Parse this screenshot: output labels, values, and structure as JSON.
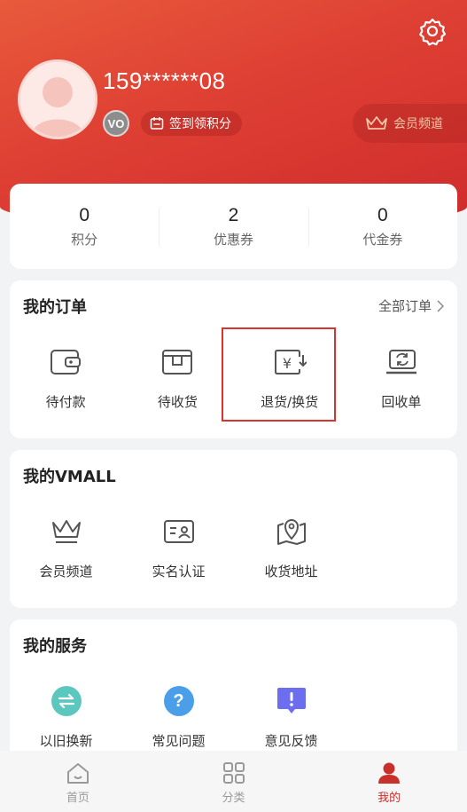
{
  "profile": {
    "phone": "159******08",
    "level_badge": "VO",
    "signin_label": "签到领积分",
    "member_channel_label": "会员频道"
  },
  "stats": [
    {
      "value": "0",
      "label": "积分"
    },
    {
      "value": "2",
      "label": "优惠券"
    },
    {
      "value": "0",
      "label": "代金券"
    }
  ],
  "orders": {
    "title": "我的订单",
    "all_link": "全部订单",
    "items": [
      {
        "label": "待付款",
        "icon": "wallet-icon"
      },
      {
        "label": "待收货",
        "icon": "package-icon"
      },
      {
        "label": "退货/换货",
        "icon": "refund-icon"
      },
      {
        "label": "回收单",
        "icon": "recycle-icon"
      }
    ]
  },
  "vmall": {
    "title": "我的VMALL",
    "items": [
      {
        "label": "会员频道",
        "icon": "crown-icon"
      },
      {
        "label": "实名认证",
        "icon": "id-card-icon"
      },
      {
        "label": "收货地址",
        "icon": "map-pin-icon"
      }
    ]
  },
  "services": {
    "title": "我的服务",
    "items": [
      {
        "label": "以旧换新",
        "icon": "trade-in-icon",
        "color": "#5cc7be"
      },
      {
        "label": "常见问题",
        "icon": "question-icon",
        "color": "#4a9fe8"
      },
      {
        "label": "意见反馈",
        "icon": "feedback-icon",
        "color": "#6d6df0"
      }
    ]
  },
  "tabbar": [
    {
      "label": "首页",
      "icon": "home-icon",
      "active": false
    },
    {
      "label": "分类",
      "icon": "grid-icon",
      "active": false
    },
    {
      "label": "我的",
      "icon": "user-icon",
      "active": true
    }
  ],
  "colors": {
    "brand_red": "#d9332f",
    "highlight_border": "#d9332f"
  }
}
